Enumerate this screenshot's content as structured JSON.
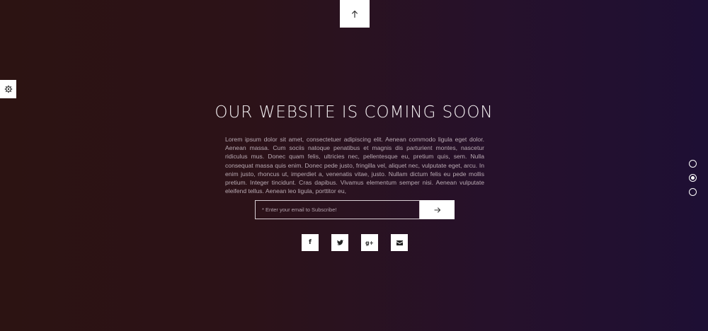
{
  "scroll_top": {
    "icon": "arrow-up-icon"
  },
  "settings": {
    "icon": "gear-icon"
  },
  "hero": {
    "title": "OUR WEBSITE IS COMING SOON",
    "description": "Lorem ipsum dolor sit amet, consectetuer adipiscing elit. Aenean commodo ligula eget dolor. Aenean massa. Cum sociis natoque penatibus et magnis dis parturient montes, nascetur ridiculus mus. Donec quam felis, ultricies nec, pellentesque eu, pretium quis, sem. Nulla consequat massa quis enim. Donec pede justo, fringilla vel, aliquet nec, vulputate eget, arcu. In enim justo, rhoncus ut, imperdiet a, venenatis vitae, justo. Nullam dictum felis eu pede mollis pretium. Integer tincidunt. Cras dapibus. Vivamus elementum semper nisi. Aenean vulputate eleifend tellus. Aenean leo ligula, porttitor eu,"
  },
  "subscribe": {
    "placeholder": "* Enter your email to Subscribe!",
    "submit_icon": "arrow-right-icon"
  },
  "social": [
    {
      "name": "facebook",
      "icon": "facebook-icon",
      "glyph": "f"
    },
    {
      "name": "twitter",
      "icon": "twitter-icon",
      "glyph": ""
    },
    {
      "name": "google-plus",
      "icon": "google-plus-icon",
      "glyph": "g+"
    },
    {
      "name": "email",
      "icon": "envelope-icon",
      "glyph": ""
    }
  ],
  "slide_dots": {
    "count": 3,
    "active_index": 1
  },
  "colors": {
    "bg_left": "#2c1312",
    "bg_right": "#1e0f34",
    "text": "#f4f0f2",
    "muted_text": "#b9aab3"
  }
}
